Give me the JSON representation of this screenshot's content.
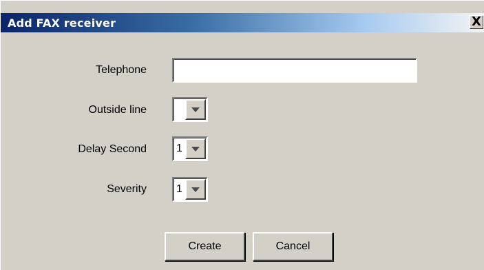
{
  "dialog": {
    "title": "Add FAX receiver",
    "close_label": "X"
  },
  "form": {
    "telephone": {
      "label": "Telephone",
      "value": ""
    },
    "outside_line": {
      "label": "Outside line",
      "value": ""
    },
    "delay_second": {
      "label": "Delay Second",
      "value": "1"
    },
    "severity": {
      "label": "Severity",
      "value": "1"
    }
  },
  "buttons": {
    "create": "Create",
    "cancel": "Cancel"
  },
  "icons": {
    "close": "close-icon",
    "dropdown": "chevron-down-icon"
  }
}
